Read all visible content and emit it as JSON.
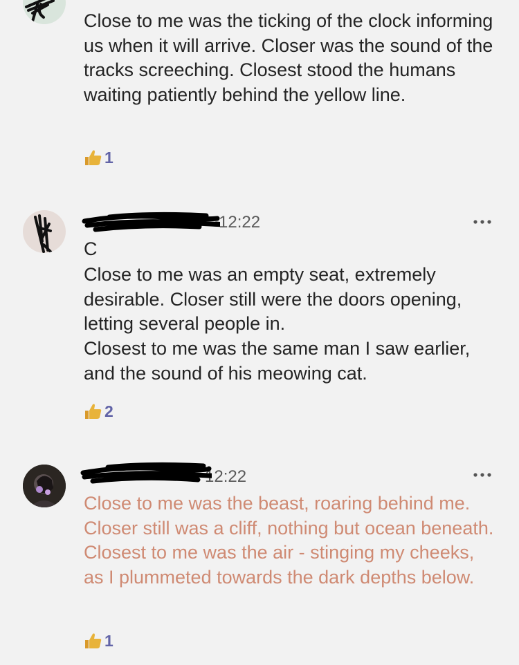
{
  "posts": [
    {
      "time": "",
      "extra_line": "",
      "body": "Close to me was the ticking of the clock informing us when it will arrive. Closer was the sound of the tracks screeching. Closest stood the humans waiting patiently behind the yellow line.",
      "reaction_count": "1",
      "style": "normal"
    },
    {
      "time": "12:22",
      "extra_line": "C",
      "body": "Close to me was an empty seat, extremely desirable. Closer still were the doors opening, letting several people in.\nClosest to me was the same man I saw earlier, and the sound of his meowing cat.",
      "reaction_count": "2",
      "style": "normal"
    },
    {
      "time": "12:22",
      "extra_line": "",
      "body": "Close to me was the beast, roaring behind me. Closer still was a cliff, nothing but ocean beneath. Closest to me was the air - stinging my cheeks, as I plummeted towards the dark depths below.",
      "reaction_count": "1",
      "style": "orange"
    }
  ],
  "icons": {
    "reaction": "thumbs-up-icon",
    "more": "more-options-icon"
  },
  "colors": {
    "background": "#f2f2f2",
    "text": "#242424",
    "orange_text": "#cf8a73",
    "reaction_count": "#6264a7",
    "thumb": "#e8b33a"
  }
}
